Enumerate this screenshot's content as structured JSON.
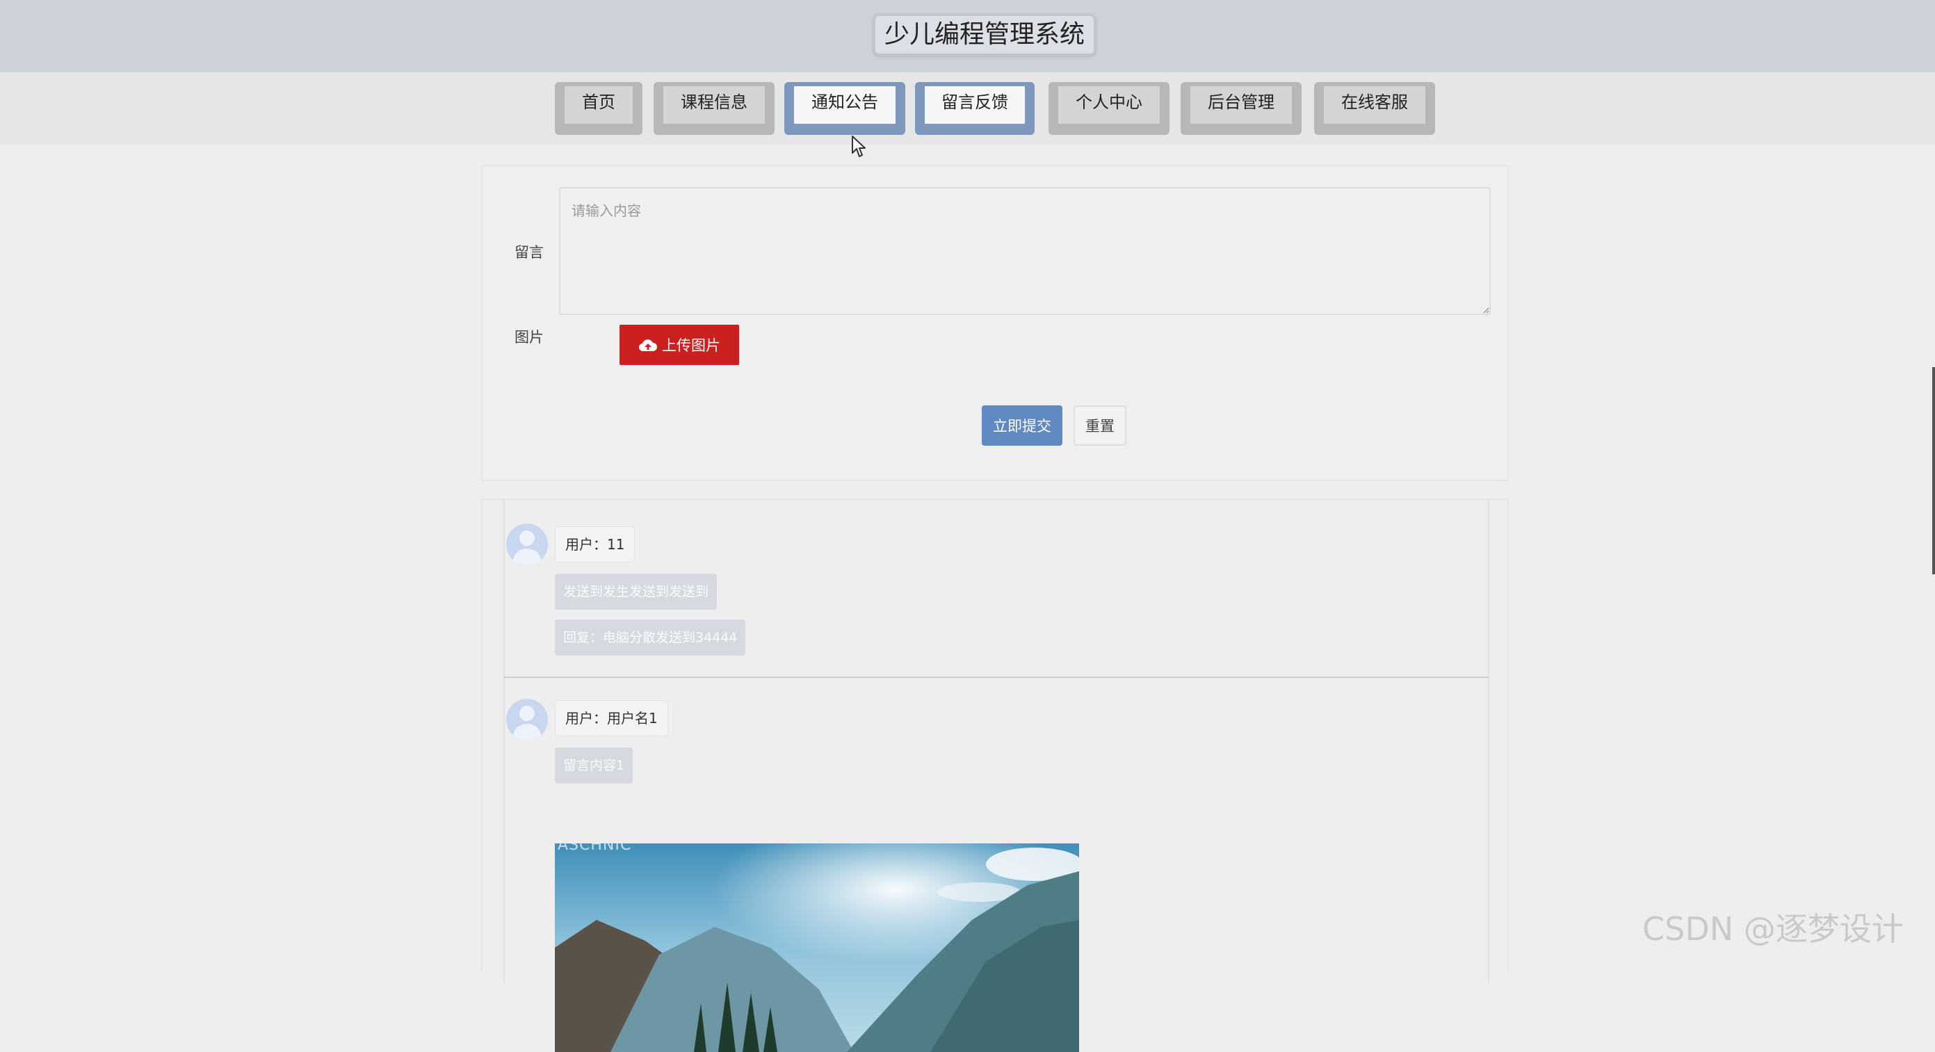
{
  "header": {
    "title": "少儿编程管理系统"
  },
  "nav": {
    "items": [
      {
        "label": "首页"
      },
      {
        "label": "课程信息"
      },
      {
        "label": "通知公告"
      },
      {
        "label": "留言反馈"
      },
      {
        "label": "个人中心"
      },
      {
        "label": "后台管理"
      },
      {
        "label": "在线客服"
      }
    ],
    "active": "留言反馈"
  },
  "form": {
    "message_label": "留言",
    "message_placeholder": "请输入内容",
    "image_label": "图片",
    "upload_label": "上传图片",
    "submit_label": "立即提交",
    "reset_label": "重置"
  },
  "messages": [
    {
      "user": "用户：11",
      "content": "发送到发生发送到发送到",
      "reply": "回复：电脑分散发送到34444"
    },
    {
      "user": "用户：用户名1",
      "content": "留言内容1",
      "image_watermark": "ASCHNIC"
    }
  ],
  "watermark": "CSDN @逐梦设计",
  "colors": {
    "header_bg": "#ccd1da",
    "active_nav_border": "#7e97bd",
    "upload_red": "#cc1f1f",
    "submit_blue": "#6089c2"
  },
  "icons": [
    "cloud-upload-icon",
    "user-avatar-icon",
    "mouse-cursor-icon"
  ]
}
